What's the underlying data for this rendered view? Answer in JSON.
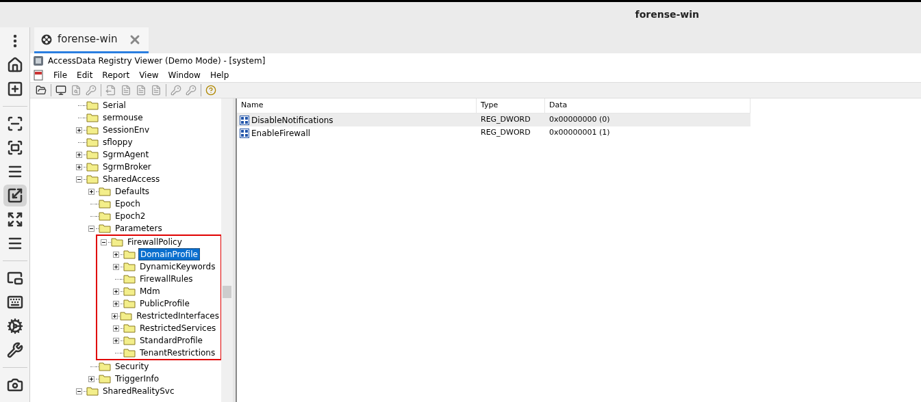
{
  "window": {
    "title": "forense-win"
  },
  "sidebar": {
    "items": [
      {
        "kind": "dots",
        "selected": false
      },
      {
        "kind": "home",
        "selected": false
      },
      {
        "kind": "add",
        "selected": false
      },
      {
        "kind": "sep"
      },
      {
        "kind": "focus",
        "selected": false
      },
      {
        "kind": "frame",
        "selected": false
      },
      {
        "kind": "lines",
        "selected": false
      },
      {
        "kind": "scale",
        "selected": true
      },
      {
        "kind": "expand",
        "selected": false
      },
      {
        "kind": "lines",
        "selected": false
      },
      {
        "kind": "sep"
      },
      {
        "kind": "pip",
        "selected": false
      },
      {
        "kind": "keyboard",
        "selected": false
      },
      {
        "kind": "gears",
        "selected": false
      },
      {
        "kind": "wrench",
        "selected": false
      },
      {
        "kind": "sep"
      },
      {
        "kind": "camera",
        "selected": false
      }
    ]
  },
  "tabs": [
    {
      "label": "forense-win",
      "selected": true
    }
  ],
  "app": {
    "title": "AccessData Registry Viewer (Demo Mode) - [system]",
    "menu": [
      "File",
      "Edit",
      "Report",
      "View",
      "Window",
      "Help"
    ],
    "toolbar": [
      {
        "kind": "open",
        "disabled": false
      },
      {
        "kind": "sep"
      },
      {
        "kind": "computer",
        "disabled": false
      },
      {
        "kind": "find",
        "disabled": true
      },
      {
        "kind": "key",
        "disabled": true
      },
      {
        "kind": "sep"
      },
      {
        "kind": "export",
        "disabled": true
      },
      {
        "kind": "doc",
        "disabled": true
      },
      {
        "kind": "doc",
        "disabled": true
      },
      {
        "kind": "doc",
        "disabled": true
      },
      {
        "kind": "sep"
      },
      {
        "kind": "key",
        "disabled": true
      },
      {
        "kind": "key",
        "disabled": true
      },
      {
        "kind": "sep"
      },
      {
        "kind": "help",
        "disabled": false
      }
    ]
  },
  "tree": [
    {
      "name": "Serial",
      "selected": false
    },
    {
      "name": "sermouse",
      "selected": false
    },
    {
      "name": "SessionEnv",
      "expanded": false,
      "selected": false
    },
    {
      "name": "sfloppy",
      "selected": false
    },
    {
      "name": "SgrmAgent",
      "expanded": false,
      "selected": false
    },
    {
      "name": "SgrmBroker",
      "expanded": false,
      "selected": false
    },
    {
      "name": "SharedAccess",
      "expanded": true,
      "selected": false,
      "children": [
        {
          "name": "Defaults",
          "expanded": false,
          "selected": false
        },
        {
          "name": "Epoch",
          "selected": false
        },
        {
          "name": "Epoch2",
          "selected": false
        },
        {
          "name": "Parameters",
          "expanded": true,
          "selected": false,
          "children": [
            {
              "name": "FirewallPolicy",
              "expanded": true,
              "selected": false,
              "highlighted": true,
              "children": [
                {
                  "name": "DomainProfile",
                  "expanded": false,
                  "selected": true
                },
                {
                  "name": "DynamicKeywords",
                  "expanded": false,
                  "selected": false
                },
                {
                  "name": "FirewallRules",
                  "selected": false
                },
                {
                  "name": "Mdm",
                  "expanded": false,
                  "selected": false
                },
                {
                  "name": "PublicProfile",
                  "expanded": false,
                  "selected": false
                },
                {
                  "name": "RestrictedInterfaces",
                  "expanded": false,
                  "selected": false
                },
                {
                  "name": "RestrictedServices",
                  "expanded": false,
                  "selected": false
                },
                {
                  "name": "StandardProfile",
                  "expanded": false,
                  "selected": false
                },
                {
                  "name": "TenantRestrictions",
                  "selected": false
                }
              ]
            }
          ]
        },
        {
          "name": "Security",
          "selected": false
        },
        {
          "name": "TriggerInfo",
          "expanded": false,
          "selected": false
        }
      ]
    },
    {
      "name": "SharedRealitySvc",
      "expanded": true,
      "selected": false
    }
  ],
  "table": {
    "columns": [
      "Name",
      "Type",
      "Data"
    ],
    "rows": [
      {
        "cells": [
          "DisableNotifications",
          "REG_DWORD",
          "0x00000000 (0)"
        ],
        "selected": true
      },
      {
        "cells": [
          "EnableFirewall",
          "REG_DWORD",
          "0x00000001 (1)"
        ],
        "selected": false
      }
    ]
  }
}
